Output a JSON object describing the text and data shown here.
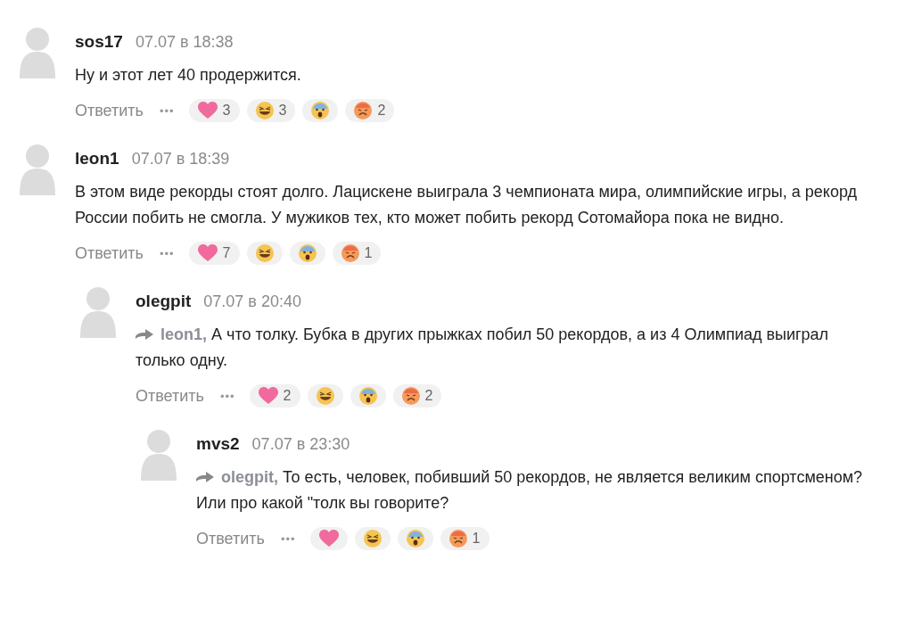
{
  "comments": [
    {
      "author": "sos17",
      "time": "07.07 в 18:38",
      "text": "Ну и этот лет 40 продержится.",
      "reply_label": "Ответить",
      "more": "•••",
      "reactions": [
        {
          "kind": "heart",
          "count": "3"
        },
        {
          "kind": "laugh",
          "count": "3"
        },
        {
          "kind": "shock"
        },
        {
          "kind": "angry",
          "count": "2"
        }
      ]
    },
    {
      "author": "leon1",
      "time": "07.07 в 18:39",
      "text": "В этом виде рекорды стоят долго. Лацискене выиграла 3 чемпионата мира, олимпийские игры, а рекорд России побить не смогла.  У мужиков тех, кто может побить рекорд Сотомайора пока не видно.",
      "reply_label": "Ответить",
      "more": "•••",
      "reactions": [
        {
          "kind": "heart",
          "count": "7"
        },
        {
          "kind": "laugh"
        },
        {
          "kind": "shock"
        },
        {
          "kind": "angry",
          "count": "1"
        }
      ],
      "children": [
        {
          "author": "olegpit",
          "time": "07.07 в 20:40",
          "reply_to": "leon1,",
          "text": "А что толку. Бубка в других прыжках побил 50 рекордов, а из 4 Олимпиад выиграл только одну.",
          "reply_label": "Ответить",
          "more": "•••",
          "reactions": [
            {
              "kind": "heart",
              "count": "2"
            },
            {
              "kind": "laugh"
            },
            {
              "kind": "shock"
            },
            {
              "kind": "angry",
              "count": "2"
            }
          ],
          "children": [
            {
              "author": "mvs2",
              "time": "07.07 в 23:30",
              "reply_to": "olegpit,",
              "text": "То есть, человек, побивший 50 рекордов, не является великим спортсменом? Или про какой \"толк вы говорите?",
              "reply_label": "Ответить",
              "more": "•••",
              "reactions": [
                {
                  "kind": "heart"
                },
                {
                  "kind": "laugh"
                },
                {
                  "kind": "shock"
                },
                {
                  "kind": "angry",
                  "count": "1"
                }
              ]
            }
          ]
        }
      ]
    }
  ]
}
